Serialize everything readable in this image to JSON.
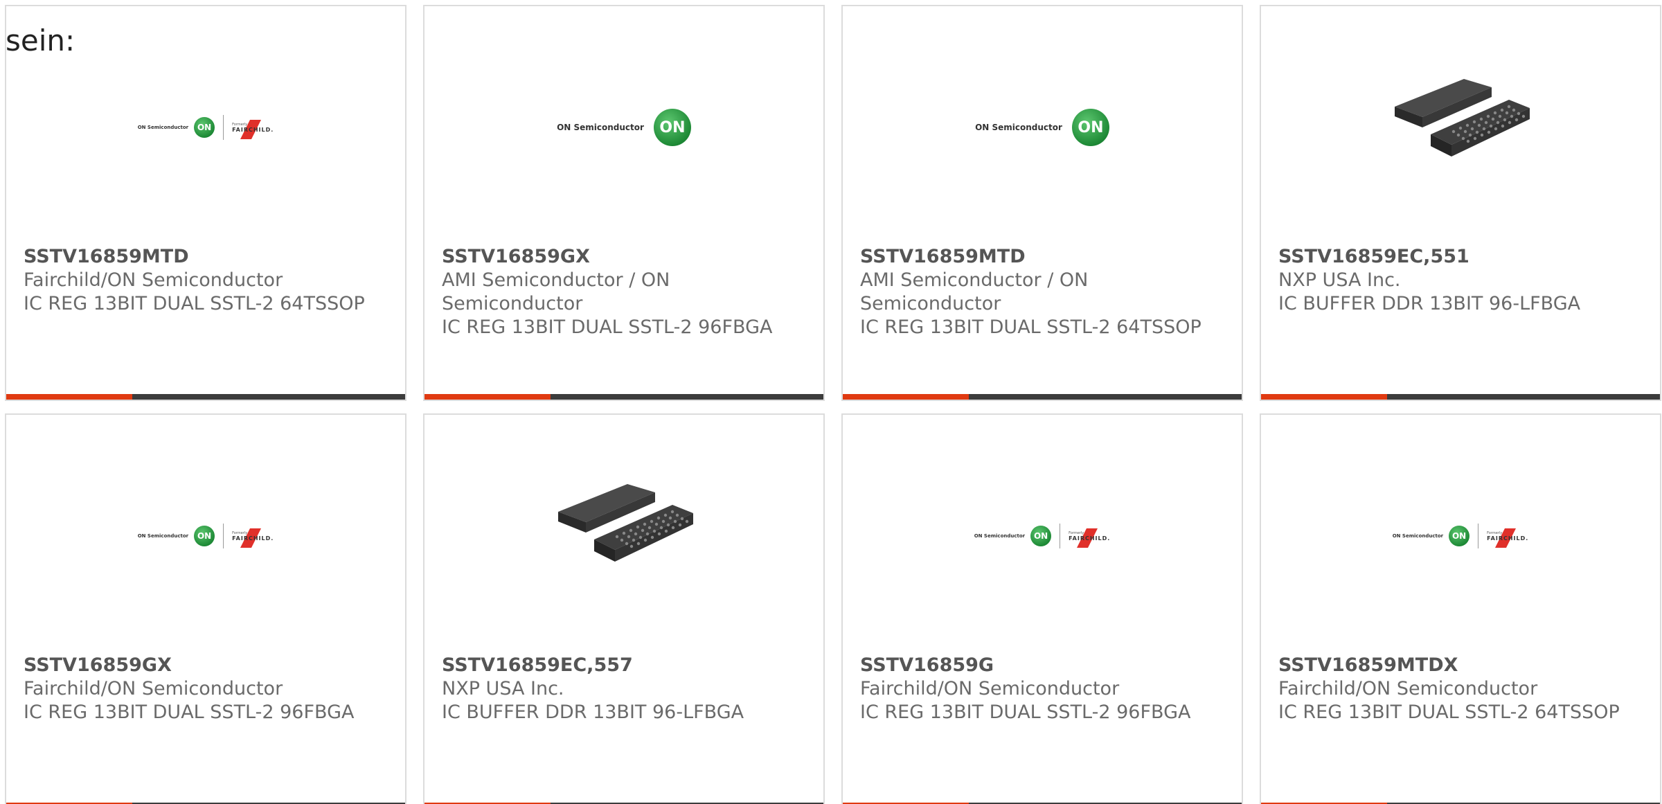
{
  "intro_text": "sein:",
  "colors": {
    "accent": "#e03a11",
    "bar_dark": "#3c3c3c",
    "border": "#dcdcdc",
    "on_green": "#1e8a36",
    "fairchild_red": "#e0302a"
  },
  "cards": [
    {
      "part": "SSTV16859MTD",
      "manufacturer": "Fairchild/ON Semiconductor",
      "description": "IC REG 13BIT DUAL SSTL-2 64TSSOP",
      "image": "on-fairchild-logo"
    },
    {
      "part": "SSTV16859GX",
      "manufacturer": "AMI Semiconductor / ON Semiconductor",
      "description": "IC REG 13BIT DUAL SSTL-2 96FBGA",
      "image": "on-semiconductor-logo"
    },
    {
      "part": "SSTV16859MTD",
      "manufacturer": "AMI Semiconductor / ON Semiconductor",
      "description": "IC REG 13BIT DUAL SSTL-2 64TSSOP",
      "image": "on-semiconductor-logo"
    },
    {
      "part": "SSTV16859EC,551",
      "manufacturer": "NXP USA Inc.",
      "description": "IC BUFFER DDR 13BIT 96-LFBGA",
      "image": "bga-chip-photo"
    },
    {
      "part": "SSTV16859GX",
      "manufacturer": "Fairchild/ON Semiconductor",
      "description": "IC REG 13BIT DUAL SSTL-2 96FBGA",
      "image": "on-fairchild-logo"
    },
    {
      "part": "SSTV16859EC,557",
      "manufacturer": "NXP USA Inc.",
      "description": "IC BUFFER DDR 13BIT 96-LFBGA",
      "image": "bga-chip-photo"
    },
    {
      "part": "SSTV16859G",
      "manufacturer": "Fairchild/ON Semiconductor",
      "description": "IC REG 13BIT DUAL SSTL-2 96FBGA",
      "image": "on-fairchild-logo"
    },
    {
      "part": "SSTV16859MTDX",
      "manufacturer": "Fairchild/ON Semiconductor",
      "description": "IC REG 13BIT DUAL SSTL-2 64TSSOP",
      "image": "on-fairchild-logo"
    }
  ],
  "logos": {
    "on_semiconductor": "ON Semiconductor",
    "on_short": "ON",
    "formerly": "Formerly",
    "fairchild": "FAIRCHILD."
  }
}
